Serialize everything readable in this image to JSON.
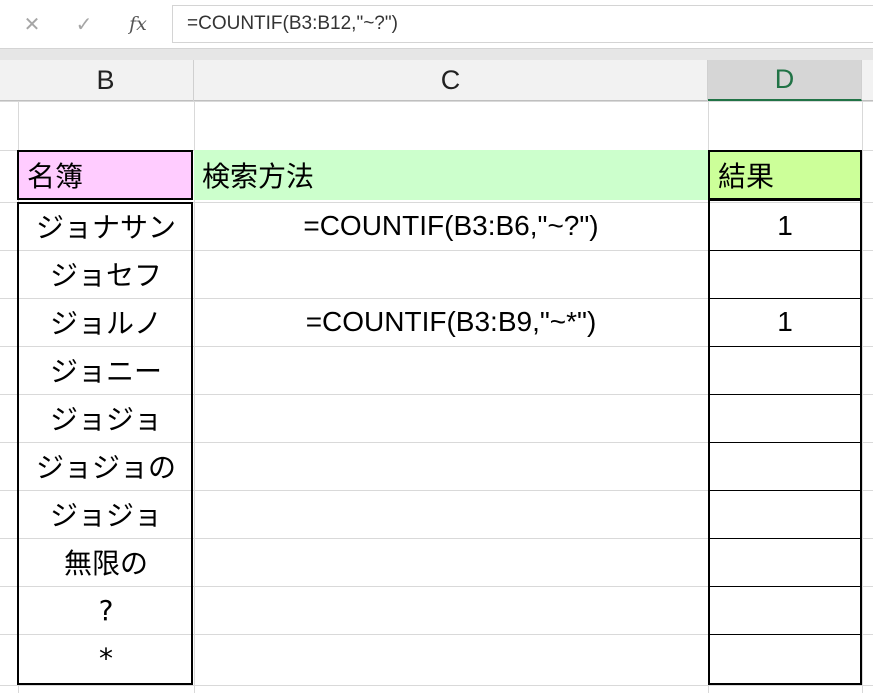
{
  "formula_bar": {
    "cancel_glyph": "✕",
    "enter_glyph": "✓",
    "fx_label": "fx",
    "formula": "=COUNTIF(B3:B12,\"~?\")"
  },
  "columns": {
    "b": "B",
    "c": "C",
    "d": "D"
  },
  "headers": {
    "b": "名簿",
    "c": "検索方法",
    "d": "結果"
  },
  "names": [
    "ジョナサン",
    "ジョセフ",
    "ジョルノ",
    "ジョニー",
    "ジョジョ",
    "ジョジョの",
    "ジョジョ",
    "無限の",
    "?",
    "*"
  ],
  "formulas": [
    "=COUNTIF(B3:B6,\"~?\")",
    "",
    "=COUNTIF(B3:B9,\"~*\")"
  ],
  "results": [
    "1",
    "",
    "1",
    "",
    "",
    "",
    "",
    "",
    "",
    ""
  ],
  "colors": {
    "name_header": "#ffccff",
    "method_header": "#ccffcc",
    "result_header": "#ccff99",
    "selected_column_text": "#217346"
  }
}
